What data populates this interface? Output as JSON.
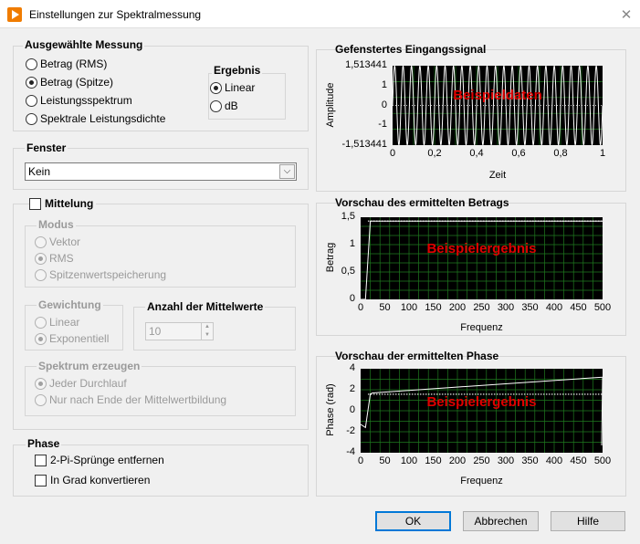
{
  "window": {
    "title": "Einstellungen zur Spektralmessung"
  },
  "measurement": {
    "label": "Ausgewählte Messung",
    "options": [
      "Betrag (RMS)",
      "Betrag (Spitze)",
      "Leistungsspektrum",
      "Spektrale Leistungsdichte"
    ],
    "selected": 1,
    "result": {
      "label": "Ergebnis",
      "options": [
        "Linear",
        "dB"
      ],
      "selected": 0
    }
  },
  "window_fn": {
    "label": "Fenster",
    "value": "Kein"
  },
  "averaging": {
    "checkbox_label": "Mittelung",
    "mode": {
      "label": "Modus",
      "options": [
        "Vektor",
        "RMS",
        "Spitzenwertspeicherung"
      ],
      "selected": 1
    },
    "weighting": {
      "label": "Gewichtung",
      "options": [
        "Linear",
        "Exponentiell"
      ],
      "selected": 1
    },
    "count": {
      "label": "Anzahl der Mittelwerte",
      "value": "10"
    },
    "spectrum": {
      "label": "Spektrum erzeugen",
      "options": [
        "Jeder Durchlauf",
        "Nur nach Ende der Mittelwertbildung"
      ],
      "selected": 0
    }
  },
  "phase": {
    "label": "Phase",
    "unwrap": "2-Pi-Sprünge entfernen",
    "degrees": "In Grad konvertieren"
  },
  "plots": [
    {
      "title": "Gefenstertes Eingangssignal",
      "xlabel": "Zeit",
      "ylabel": "Amplitude",
      "overlay": "Beispieldaten",
      "yticks": [
        "1,513441",
        "1",
        "0",
        "-1",
        "-1,513441"
      ],
      "xticks": [
        "0",
        "0,2",
        "0,4",
        "0,6",
        "0,8",
        "1"
      ]
    },
    {
      "title": "Vorschau des ermittelten Betrags",
      "xlabel": "Frequenz",
      "ylabel": "Betrag",
      "overlay": "Beispielergebnis",
      "yticks": [
        "1,5",
        "1",
        "0,5",
        "0"
      ],
      "xticks": [
        "0",
        "50",
        "100",
        "150",
        "200",
        "250",
        "300",
        "350",
        "400",
        "450",
        "500"
      ]
    },
    {
      "title": "Vorschau der ermittelten Phase",
      "xlabel": "Frequenz",
      "ylabel": "Phase (rad)",
      "overlay": "Beispielergebnis",
      "yticks": [
        "4",
        "2",
        "0",
        "-2",
        "-4"
      ],
      "xticks": [
        "0",
        "50",
        "100",
        "150",
        "200",
        "250",
        "300",
        "350",
        "400",
        "450",
        "500"
      ]
    }
  ],
  "buttons": {
    "ok": "OK",
    "cancel": "Abbrechen",
    "help": "Hilfe"
  },
  "colors": {
    "plot_bg": "#000000",
    "grid": "#1f7a1f",
    "trace": "#ffffff",
    "overlay": "#e00000",
    "accent": "#0078d7",
    "app_icon": "#f07c00"
  },
  "chart_data": [
    {
      "type": "line",
      "title": "Gefenstertes Eingangssignal",
      "xlabel": "Zeit",
      "ylabel": "Amplitude",
      "xlim": [
        0,
        1
      ],
      "ylim": [
        -1.513441,
        1.513441
      ],
      "grid": true,
      "series": [
        {
          "values_desc": null,
          "x": [
            0,
            1
          ],
          "amplitude": 1.513441,
          "cycles": 25
        }
      ]
    },
    {
      "type": "line",
      "title": "Vorschau des ermittelten Betrags",
      "xlabel": "Frequenz",
      "ylabel": "Betrag",
      "xlim": [
        0,
        500
      ],
      "ylim": [
        0,
        1.5
      ],
      "grid": true,
      "series": [
        {
          "x": [
            0,
            10,
            20,
            25,
            500
          ],
          "values": [
            0,
            0,
            1.43,
            1.43,
            1.43
          ]
        }
      ]
    },
    {
      "type": "line",
      "title": "Vorschau der ermittelten Phase",
      "xlabel": "Frequenz",
      "ylabel": "Phase (rad)",
      "xlim": [
        0,
        500
      ],
      "ylim": [
        -4,
        4
      ],
      "grid": true,
      "series": [
        {
          "x": [
            0,
            10,
            20,
            25,
            500
          ],
          "values": [
            -1.3,
            -1.6,
            1.6,
            1.7,
            3.2
          ]
        }
      ]
    }
  ]
}
